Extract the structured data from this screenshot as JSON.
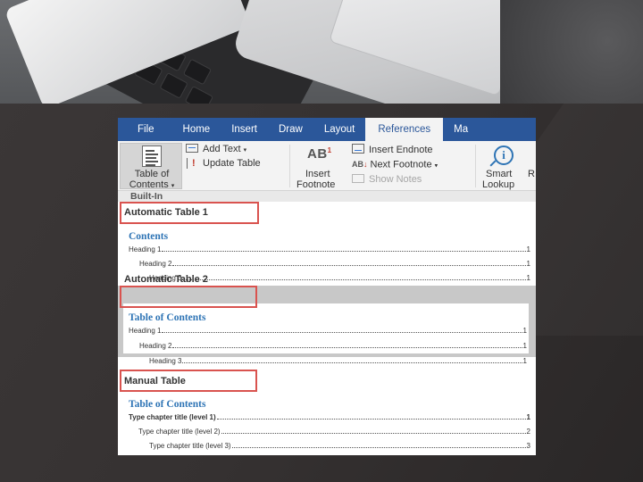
{
  "ribbon_tabs": [
    "File",
    "Home",
    "Insert",
    "Draw",
    "Layout",
    "References",
    "Ma"
  ],
  "active_tab": "References",
  "ribbon": {
    "toc_button": "Table of",
    "toc_button_line2": "Contents",
    "add_text": "Add Text",
    "update_table": "Update Table",
    "insert_footnote_line1": "Insert",
    "insert_footnote_line2": "Footnote",
    "footnote_glyph": "AB",
    "footnote_sup": "1",
    "insert_endnote": "Insert Endnote",
    "next_footnote": "Next Footnote",
    "show_notes": "Show Notes",
    "smart_lookup_line1": "Smart",
    "smart_lookup_line2": "Lookup",
    "cut_label": "R"
  },
  "gallery": {
    "section_header": "Built-In",
    "options": [
      {
        "name": "Automatic Table 1",
        "heading": "Contents",
        "entries": [
          {
            "text": "Heading 1",
            "page": "1"
          },
          {
            "text": "Heading 2",
            "page": "1"
          },
          {
            "text": "Heading 3",
            "page": "1"
          }
        ]
      },
      {
        "name": "Automatic Table 2",
        "heading": "Table of Contents",
        "entries": [
          {
            "text": "Heading 1",
            "page": "1"
          },
          {
            "text": "Heading 2",
            "page": "1"
          },
          {
            "text": "Heading 3",
            "page": "1"
          }
        ]
      },
      {
        "name": "Manual Table",
        "heading": "Table of Contents",
        "entries": [
          {
            "text": "Type chapter title (level 1)",
            "page": "1"
          },
          {
            "text": "Type chapter title (level 2)",
            "page": "2"
          },
          {
            "text": "Type chapter title (level 3)",
            "page": "3"
          }
        ]
      }
    ]
  },
  "colors": {
    "ribbon_blue": "#2b579a",
    "heading_blue": "#2e74b5",
    "highlight_red": "#d9534f"
  }
}
